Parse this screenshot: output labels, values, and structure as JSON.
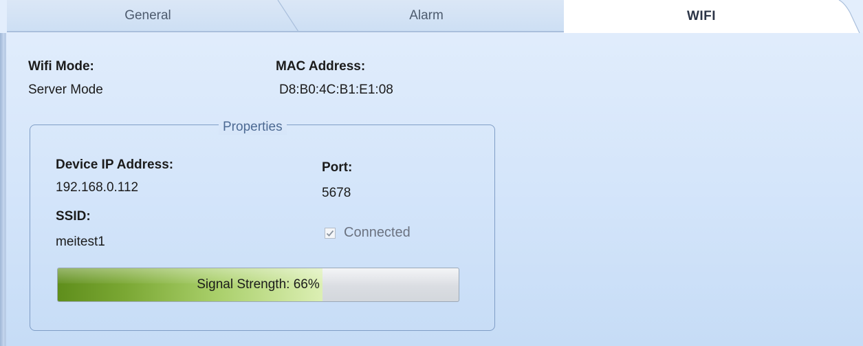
{
  "tabs": [
    {
      "label": "General",
      "active": false
    },
    {
      "label": "Alarm",
      "active": false
    },
    {
      "label": "WIFI",
      "active": true
    }
  ],
  "wifi_mode": {
    "label": "Wifi Mode:",
    "value": "Server Mode"
  },
  "mac_address": {
    "label": "MAC Address:",
    "value": "D8:B0:4C:B1:E1:08"
  },
  "properties": {
    "title": "Properties",
    "device_ip": {
      "label": "Device IP Address:",
      "value": "192.168.0.112"
    },
    "port": {
      "label": "Port:",
      "value": "5678"
    },
    "ssid": {
      "label": "SSID:",
      "value": "meitest1"
    },
    "connected": {
      "label": "Connected",
      "checked": true,
      "enabled": false
    },
    "signal": {
      "label": "Signal Strength: 66%",
      "percent": 66
    }
  },
  "colors": {
    "accent_green": "#7aa733",
    "tab_active_bg": "#ffffff",
    "panel_bg": "#d4e5fa",
    "groupbox_border": "#7f9dc6"
  }
}
